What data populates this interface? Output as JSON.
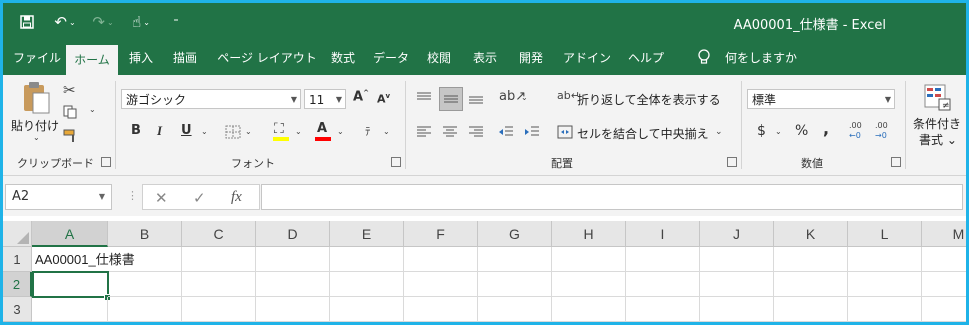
{
  "title": {
    "text": "AA00001_仕様書  -  Excel"
  },
  "quick_access": [
    {
      "name": "save-icon",
      "glyph": "💾"
    },
    {
      "name": "undo-icon",
      "glyph": "↶"
    },
    {
      "name": "redo-icon",
      "glyph": "↷"
    },
    {
      "name": "touch-mode-icon",
      "glyph": "☝"
    },
    {
      "name": "customize-icon",
      "glyph": "⁼"
    }
  ],
  "tabs": [
    "ファイル",
    "ホーム",
    "挿入",
    "描画",
    "ページ レイアウト",
    "数式",
    "データ",
    "校閲",
    "表示",
    "開発",
    "アドイン",
    "ヘルプ"
  ],
  "active_tab": "ホーム",
  "tell_me": "何をしますか",
  "ribbon": {
    "clipboard": {
      "paste": "貼り付け",
      "label": "クリップボード"
    },
    "font": {
      "font_name": "游ゴシック",
      "font_size": "11",
      "bold": "B",
      "italic": "I",
      "underline": "U",
      "label": "フォント",
      "grow": "A",
      "shrink": "A",
      "color_letter": "A"
    },
    "alignment": {
      "wrap_text": "折り返して全体を表示する",
      "merge_center": "セルを結合して中央揃え",
      "label": "配置"
    },
    "number": {
      "format": "標準",
      "currency": "$",
      "percent": "%",
      "comma": ",",
      "inc_decimal": ".00",
      "dec_decimal": ".00",
      "label": "数値"
    },
    "styles": {
      "conditional": "条件付き",
      "conditional2": "書式",
      "chevron": "⌄"
    }
  },
  "formula_bar": {
    "name_box": "A2",
    "cancel": "✕",
    "enter": "✓",
    "fx": "fx",
    "value": ""
  },
  "grid": {
    "columns": [
      "A",
      "B",
      "C",
      "D",
      "E",
      "F",
      "G",
      "H",
      "I",
      "J",
      "K",
      "L",
      "M"
    ],
    "rows": [
      "1",
      "2",
      "3"
    ],
    "selected_column": "A",
    "selected_row": "2",
    "cells": {
      "A1": "AA00001_仕様書"
    }
  },
  "colors": {
    "accent": "#217346",
    "window_border": "#1fb3e8"
  }
}
